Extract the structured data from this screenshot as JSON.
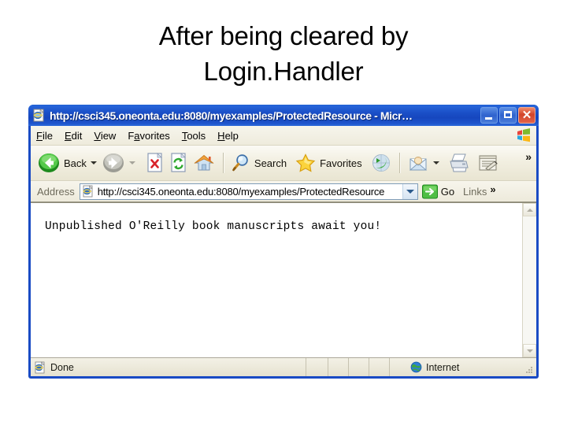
{
  "slide": {
    "title_line1": "After being cleared by",
    "title_line2": "Login.Handler",
    "background": "#ffffff"
  },
  "window": {
    "title": "http://csci345.oneonta.edu:8080/myexamples/ProtectedResource - Micr…",
    "title_icon": "ie-document-icon",
    "accent_color": "#1A4BC4",
    "controls": [
      {
        "name": "minimize-button",
        "glyph": "_"
      },
      {
        "name": "restore-button",
        "glyph": "❐"
      },
      {
        "name": "close-button",
        "glyph": "✕"
      }
    ]
  },
  "menubar": {
    "items": [
      {
        "label": "File",
        "accel": "F"
      },
      {
        "label": "Edit",
        "accel": "E"
      },
      {
        "label": "View",
        "accel": "V"
      },
      {
        "label": "Favorites",
        "accel": "a"
      },
      {
        "label": "Tools",
        "accel": "T"
      },
      {
        "label": "Help",
        "accel": "H"
      }
    ],
    "brand_icon": "windows-flag-icon"
  },
  "toolbar": {
    "back_label": "Back",
    "search_label": "Search",
    "favorites_label": "Favorites",
    "overflow_label": "»",
    "icons": [
      "back-arrow-icon",
      "forward-arrow-icon",
      "stop-icon",
      "refresh-icon",
      "home-icon",
      "search-icon",
      "favorites-star-icon",
      "media-globe-icon",
      "mail-icon",
      "print-icon",
      "edit-icon"
    ]
  },
  "address": {
    "label": "Address",
    "url": "http://csci345.oneonta.edu:8080/myexamples/ProtectedResource",
    "placeholder": "",
    "go_label": "Go",
    "links_label": "Links",
    "overflow_label": "»",
    "icon": "ie-document-icon",
    "dropdown_icon": "chevron-down-icon",
    "go_icon": "go-arrow-icon"
  },
  "page": {
    "text": "Unpublished O'Reilly book manuscripts await you!"
  },
  "scrollbar": {
    "up_icon": "scroll-up-arrow-icon",
    "down_icon": "scroll-down-arrow-icon"
  },
  "statusbar": {
    "status_text": "Done",
    "status_icon": "ie-document-icon",
    "zone_text": "Internet",
    "zone_icon": "globe-icon",
    "grip_icon": "resize-grip-icon"
  }
}
